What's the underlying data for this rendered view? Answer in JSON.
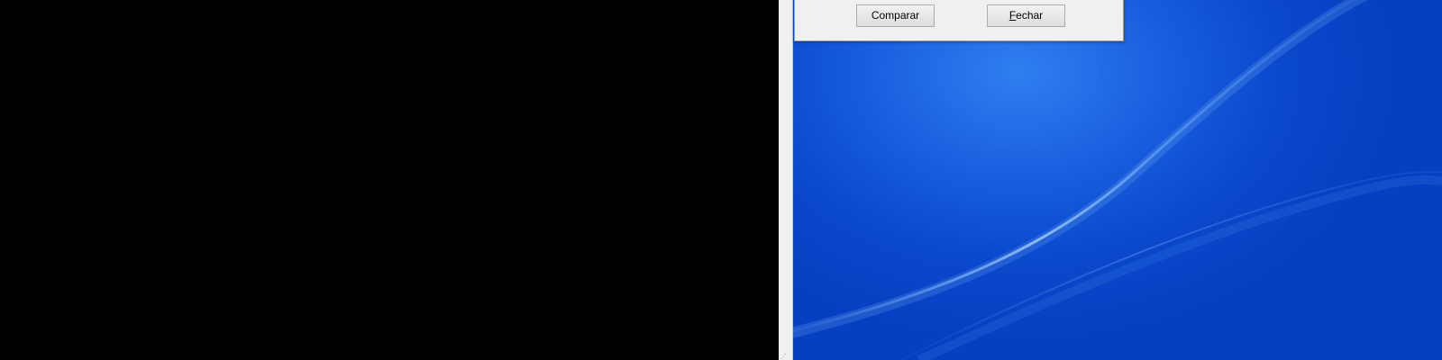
{
  "dialog": {
    "buttons": {
      "compare_label": "Comparar",
      "close_mnemonic": "F",
      "close_rest": "echar"
    }
  },
  "desktop": {
    "wallpaper": "windows-blue-wallpaper",
    "colors": {
      "primary_blue": "#0a48cc",
      "highlight_blue": "#2f7ff0",
      "left_pane": "#000000"
    }
  }
}
